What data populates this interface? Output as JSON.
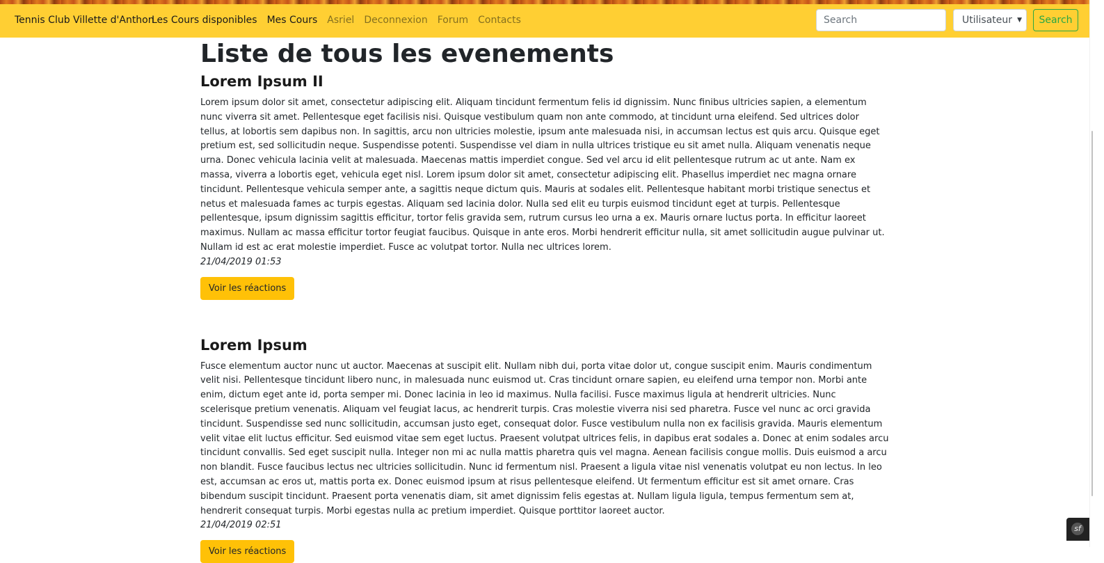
{
  "navbar": {
    "brand": "Tennis Club Villette d'Anthon",
    "links": [
      {
        "label": "Les Cours disponibles"
      },
      {
        "label": "Mes Cours"
      },
      {
        "label": "Asriel"
      },
      {
        "label": "Deconnexion"
      },
      {
        "label": "Forum"
      },
      {
        "label": "Contacts"
      }
    ],
    "search": {
      "placeholder": "Search",
      "value": ""
    },
    "type_select": {
      "selected": "Utilisateur"
    },
    "search_button": "Search"
  },
  "main": {
    "title": "Liste de tous les evenements",
    "events": [
      {
        "title": "Lorem Ipsum II",
        "body": "Lorem ipsum dolor sit amet, consectetur adipiscing elit. Aliquam tincidunt fermentum felis id dignissim. Nunc finibus ultricies sapien, a elementum nunc viverra sit amet. Pellentesque eget facilisis nisi. Quisque vestibulum quam non ante commodo, at tincidunt urna eleifend. Sed ultrices dolor tellus, at lobortis sem dapibus non. In sagittis, arcu non ultricies molestie, ipsum ante malesuada nisi, in accumsan lectus est quis arcu. Quisque eget pretium est, sed sollicitudin neque. Suspendisse potenti. Suspendisse vel diam in nulla ultrices tristique eu sit amet nulla. Aliquam venenatis neque urna. Donec vehicula lacinia velit at malesuada. Maecenas mattis imperdiet congue. Sed vel arcu id elit pellentesque rutrum ac ut ante. Nam ex massa, viverra a lobortis eget, vehicula eget nisl. Lorem ipsum dolor sit amet, consectetur adipiscing elit. Phasellus imperdiet nec magna ornare tincidunt. Pellentesque vehicula semper ante, a sagittis neque dictum quis. Mauris at sodales elit. Pellentesque habitant morbi tristique senectus et netus et malesuada fames ac turpis egestas. Aliquam sed lacinia dolor. Nulla sed elit eu turpis euismod tincidunt eget at turpis. Pellentesque pellentesque, ipsum dignissim sagittis efficitur, tortor felis gravida sem, rutrum cursus leo urna a ex. Mauris ornare luctus porta. In efficitur laoreet maximus. Nullam ac massa efficitur tortor feugiat faucibus. Quisque in ante eros. Morbi hendrerit efficitur nulla, sit amet sollicitudin augue pulvinar ut. Nullam id est ac erat molestie imperdiet. Fusce ac volutpat tortor. Nulla nec ultrices lorem.",
        "date": "21/04/2019 01:53",
        "button": "Voir les réactions"
      },
      {
        "title": "Lorem Ipsum",
        "body": "Fusce elementum auctor nunc ut auctor. Maecenas at suscipit elit. Nullam nibh dui, porta vitae dolor ut, congue suscipit enim. Mauris condimentum velit nisi. Pellentesque tincidunt libero nunc, in malesuada nunc euismod ut. Cras tincidunt ornare sapien, eu eleifend urna tempor non. Morbi ante enim, dictum eget ante id, porta semper mi. Donec lacinia in leo id maximus. Nulla facilisi. Fusce maximus ligula at hendrerit ultricies. Nunc scelerisque pretium venenatis. Aliquam vel feugiat lacus, ac hendrerit turpis. Cras molestie viverra nisi sed pharetra. Fusce vel nunc ac orci gravida tincidunt. Suspendisse sed nunc sollicitudin, accumsan justo eget, consequat dolor. Fusce vestibulum nulla non ex facilisis gravida. Mauris elementum velit vitae elit luctus efficitur. Sed euismod vitae sem eget luctus. Praesent volutpat ultrices felis, in dapibus erat sodales a. Donec at enim sodales arcu tincidunt convallis. Sed eget suscipit nulla. Integer non mi ac nulla mattis pharetra quis vel magna. Aenean facilisis congue mollis. Duis euismod a arcu non blandit. Fusce faucibus lectus nec ultricies sollicitudin. Nunc id fermentum nisl. Praesent a ligula vitae nisl venenatis volutpat eu non lectus. In leo est, accumsan ac eros ut, mattis porta ex. Donec euismod ipsum at risus pellentesque eleifend. Ut fermentum efficitur est sit amet ornare. Cras bibendum suscipit tincidunt. Praesent porta venenatis diam, sit amet dignissim felis egestas at. Nullam ligula ligula, tempus fermentum sem at, hendrerit consequat turpis. Morbi egestas nulla ac pretium imperdiet. Quisque porttitor laoreet auctor.",
        "date": "21/04/2019 02:51",
        "button": "Voir les réactions"
      }
    ]
  },
  "colors": {
    "navbar_bg": "#ffcf33",
    "button_bg": "#ffc107",
    "search_button": "#28a745"
  },
  "icons": {
    "select_caret": "chevron-down-icon",
    "debug_toolbar": "symfony-logo-icon"
  },
  "debug_toolbar": {
    "logo": "sf"
  }
}
